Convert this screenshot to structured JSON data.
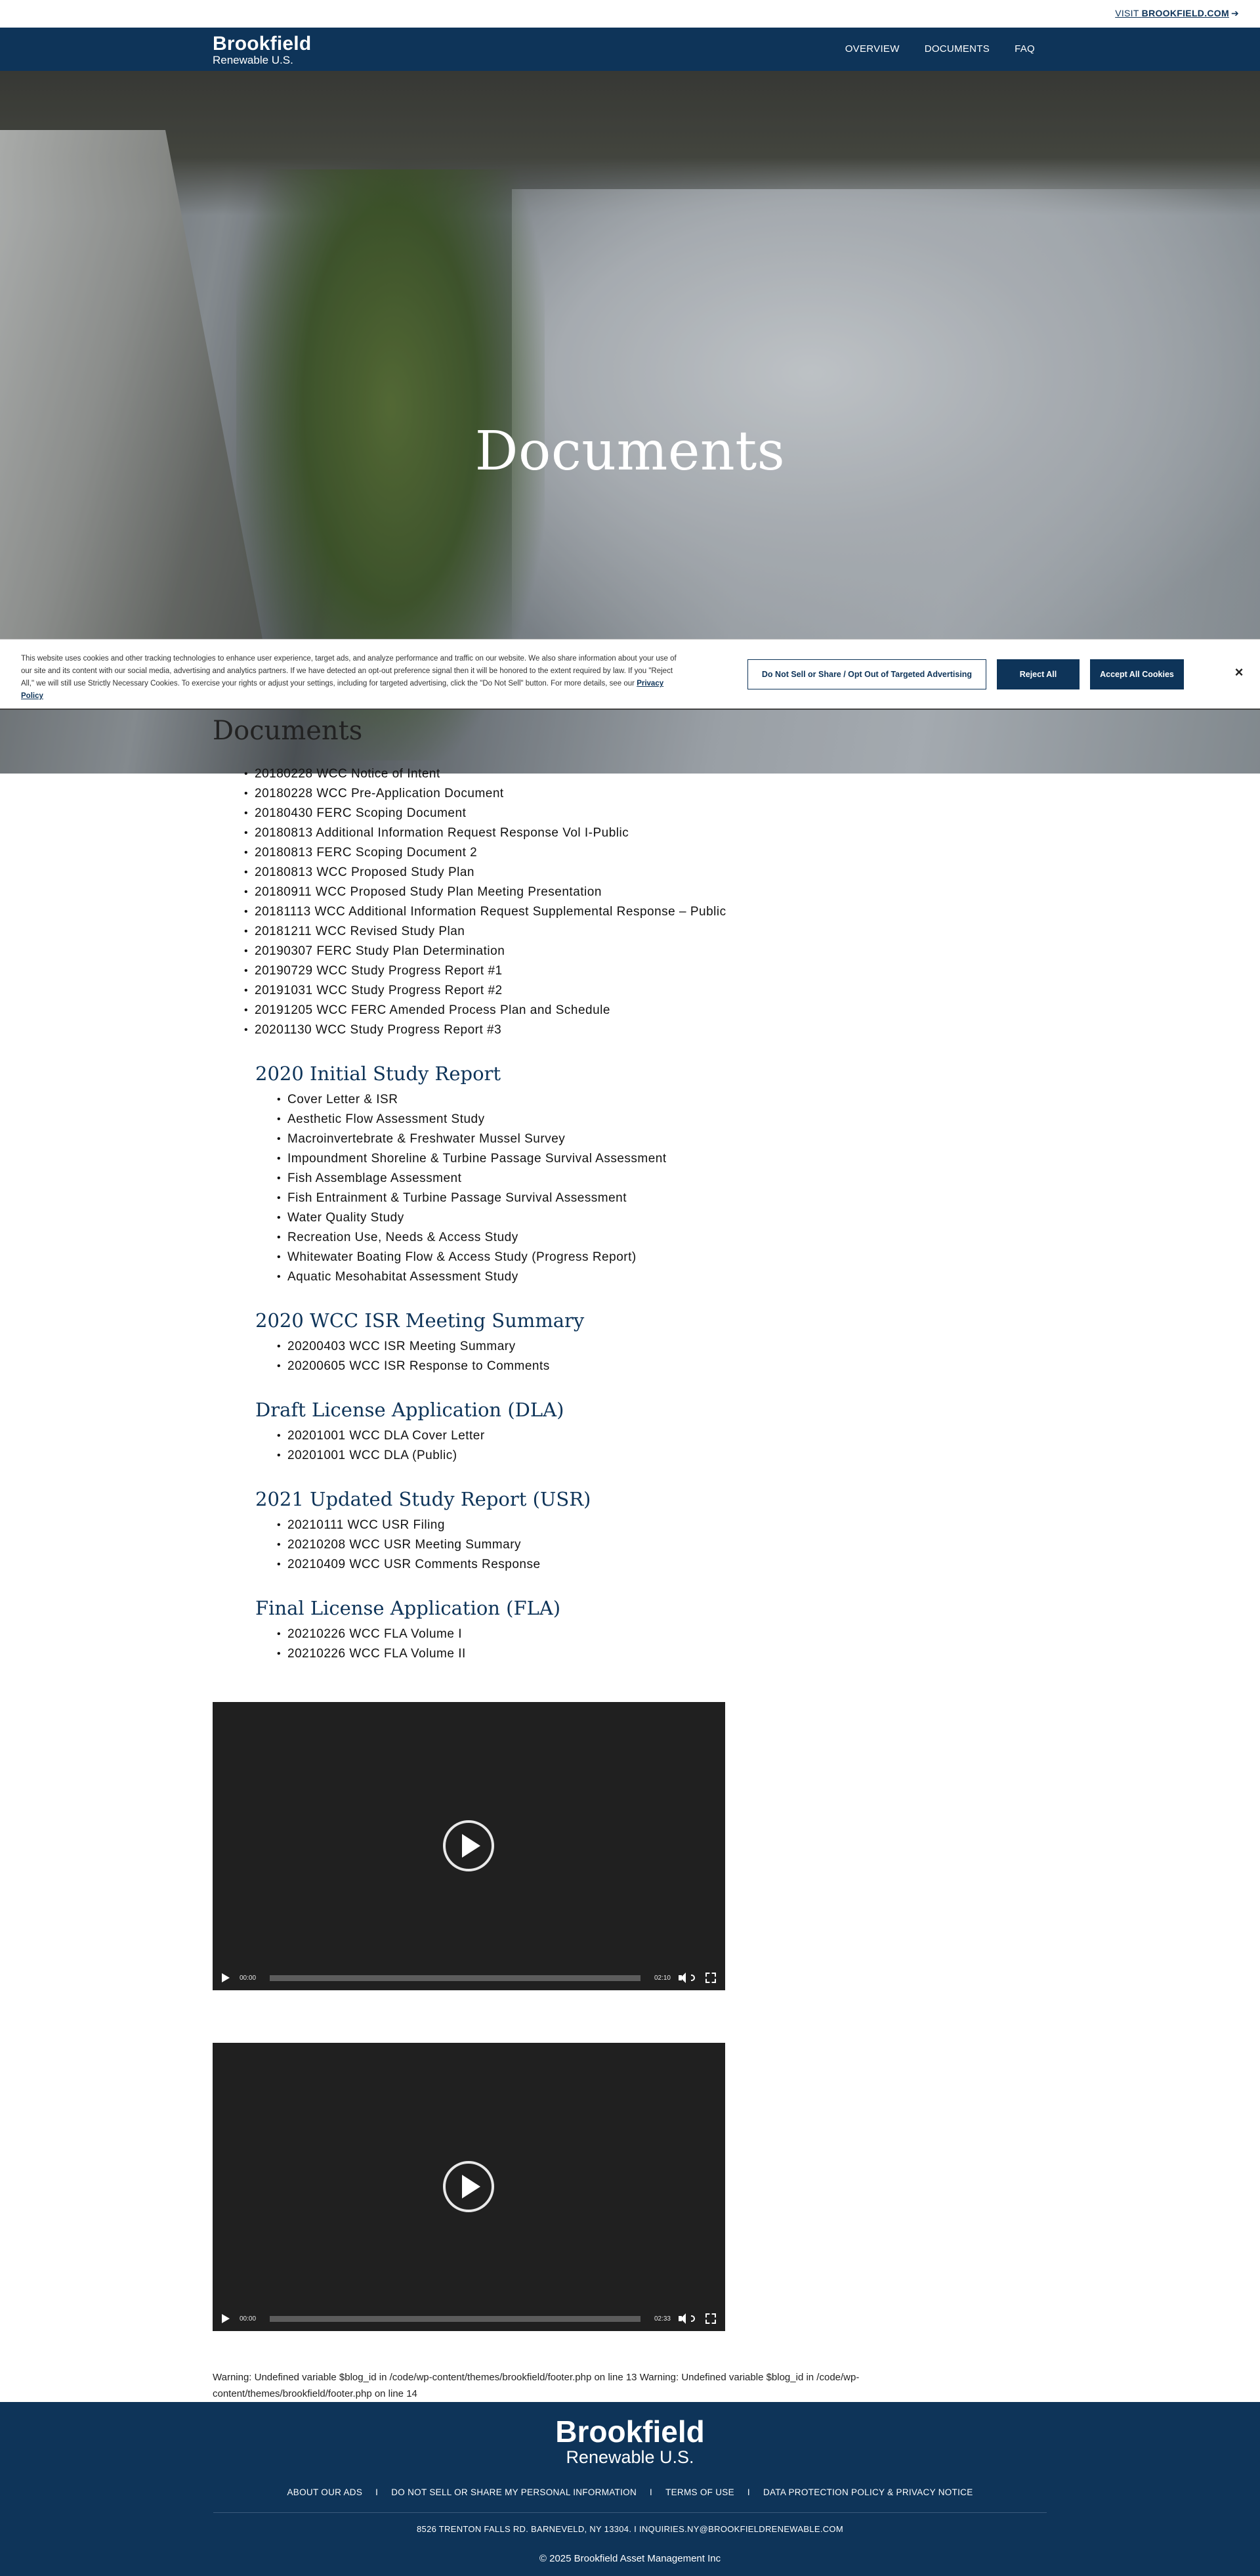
{
  "utility": {
    "visit_prefix": "VISIT ",
    "visit_site": "BROOKFIELD.COM",
    "visit_arrow": "➔"
  },
  "brand": {
    "line1": "Brookfield",
    "line2": "Renewable U.S."
  },
  "nav": {
    "items": [
      "OVERVIEW",
      "DOCUMENTS",
      "FAQ"
    ]
  },
  "hero": {
    "title": "Documents"
  },
  "cookie": {
    "text": "This website uses cookies and other tracking technologies to enhance user experience, target ads, and analyze performance and traffic on our website. We also share information about your use of our site and its content with our social media, advertising and analytics partners. If we have detected an opt-out preference signal then it will be honored to the extent required by law. If you \"Reject All,\" we will still use Strictly Necessary Cookies. To exercise your rights or adjust your settings, including for targeted advertising, click the \"Do Not Sell\" button. For more details, see our ",
    "privacy_link": "Privacy Policy",
    "optout_label": "Do Not Sell or Share / Opt Out of Targeted Advertising",
    "reject_label": "Reject All",
    "accept_label": "Accept All Cookies",
    "close_glyph": "×"
  },
  "main": {
    "heading": "Documents",
    "documents": [
      "20180228 WCC Notice of Intent",
      "20180228 WCC Pre-Application Document",
      "20180430 FERC Scoping Document",
      "20180813 Additional Information Request Response Vol I-Public",
      "20180813 FERC Scoping Document 2",
      "20180813 WCC Proposed Study Plan",
      "20180911 WCC Proposed Study Plan Meeting Presentation",
      "20181113 WCC Additional Information Request Supplemental Response – Public",
      "20181211 WCC Revised Study Plan",
      "20190307 FERC Study Plan Determination",
      "20190729 WCC Study Progress Report #1",
      "20191031 WCC Study Progress Report #2",
      "20191205 WCC FERC Amended Process Plan and Schedule",
      "20201130 WCC Study Progress Report #3"
    ],
    "sections": [
      {
        "title": "2020 Initial Study Report",
        "items": [
          "Cover Letter & ISR",
          "Aesthetic Flow Assessment Study",
          "Macroinvertebrate & Freshwater Mussel Survey",
          "Impoundment Shoreline & Turbine Passage Survival Assessment",
          "Fish Assemblage Assessment",
          "Fish Entrainment & Turbine Passage Survival Assessment",
          "Water Quality Study",
          "Recreation Use, Needs & Access Study",
          "Whitewater Boating Flow & Access Study (Progress Report)",
          "Aquatic Mesohabitat Assessment Study"
        ]
      },
      {
        "title": "2020 WCC ISR Meeting Summary",
        "items": [
          "20200403 WCC ISR Meeting Summary",
          "20200605 WCC ISR Response to Comments"
        ]
      },
      {
        "title": "Draft License Application (DLA)",
        "items": [
          "20201001 WCC DLA Cover Letter",
          "20201001 WCC DLA (Public)"
        ]
      },
      {
        "title": "2021 Updated Study Report (USR)",
        "items": [
          "20210111 WCC USR Filing",
          "20210208 WCC USR Meeting Summary",
          "20210409 WCC USR Comments Response"
        ]
      },
      {
        "title": "Final License Application (FLA)",
        "items": [
          "20210226 WCC FLA Volume I",
          "20210226 WCC FLA Volume II"
        ]
      }
    ]
  },
  "videos": [
    {
      "current": "00:00",
      "duration": "02:10"
    },
    {
      "current": "00:00",
      "duration": "02:33"
    }
  ],
  "warning": "Warning: Undefined variable $blog_id in /code/wp-content/themes/brookfield/footer.php on line 13 Warning: Undefined variable $blog_id in /code/wp-content/themes/brookfield/footer.php on line 14",
  "footer": {
    "links": [
      "ABOUT OUR ADS",
      "DO NOT SELL OR SHARE MY PERSONAL INFORMATION",
      "TERMS OF USE",
      "DATA PROTECTION POLICY & PRIVACY NOTICE"
    ],
    "separator": "I",
    "address": "8526 TRENTON FALLS RD. BARNEVELD, NY 13304. I INQUIRIES.NY@BROOKFIELDRENEWABLE.COM",
    "copyright": "© 2025 Brookfield Asset Management Inc"
  },
  "colors": {
    "navy": "#0e3459",
    "player_bg": "#202020"
  }
}
